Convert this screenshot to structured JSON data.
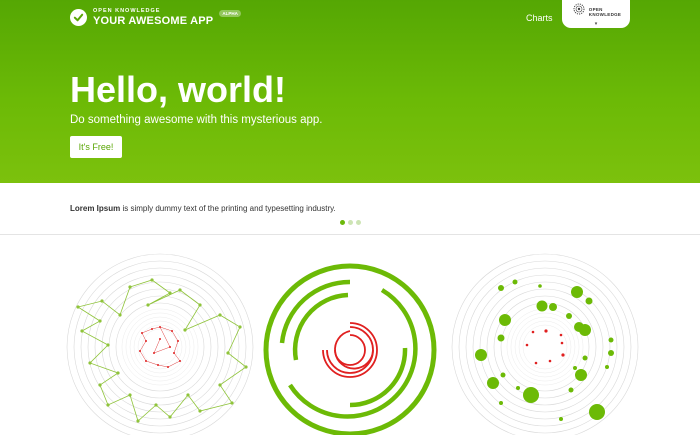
{
  "header": {
    "brand_top": "OPEN KNOWLEDGE",
    "brand_main": "YOUR AWESOME APP",
    "brand_badge": "ALPHA",
    "nav_charts": "Charts",
    "ok_logo_line1": "OPEN",
    "ok_logo_line2": "KNOWLEDGE",
    "ok_caret": "▾"
  },
  "hero": {
    "title": "Hello, world!",
    "subtitle": "Do something awesome with this mysterious app.",
    "cta_label": "It's Free!"
  },
  "strip": {
    "bold_text": "Lorem Ipsum",
    "rest_text": " is simply dummy text of the printing and typesetting industry.",
    "active_dot": 0,
    "dot_count": 3
  },
  "colors": {
    "green_dark": "#55a704",
    "green_light": "#7cc10d",
    "accent_green": "#6cba06",
    "red": "#e02020"
  }
}
